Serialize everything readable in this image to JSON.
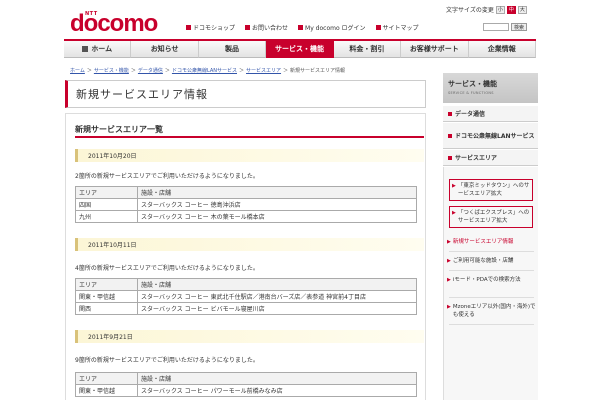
{
  "header": {
    "logo_small": "NTT",
    "logo": "docomo",
    "font_size_label": "文字サイズの変更",
    "font_sizes": [
      "小",
      "中",
      "大"
    ],
    "links": [
      "ドコモショップ",
      "お問い合わせ",
      "My docomo ログイン",
      "サイトマップ"
    ],
    "search_button": "検索"
  },
  "nav": {
    "tabs": [
      "ホーム",
      "お知らせ",
      "製品",
      "サービス・機能",
      "料金・割引",
      "お客様サポート",
      "企業情報"
    ],
    "active": "サービス・機能"
  },
  "breadcrumb": {
    "items": [
      "ホーム",
      "サービス・機能",
      "データ通信",
      "ドコモ公衆無線LANサービス",
      "サービスエリア"
    ],
    "current": "新規サービスエリア情報",
    "separator": "＞"
  },
  "main": {
    "page_title": "新規サービスエリア情報",
    "section_title": "新規サービスエリア一覧",
    "table_headers": [
      "エリア",
      "施設・店舗"
    ],
    "entries": [
      {
        "date": "2011年10月20日",
        "note": "2箇所の新規サービスエリアでご利用いただけるようになりました。",
        "rows": [
          [
            "四国",
            "スターバックス コーヒー 徳島沖浜店"
          ],
          [
            "九州",
            "スターバックス コーヒー 木の葉モール橋本店"
          ]
        ]
      },
      {
        "date": "2011年10月11日",
        "note": "4箇所の新規サービスエリアでご利用いただけるようになりました。",
        "rows": [
          [
            "関東・甲信越",
            "スターバックス コーヒー 東武北千住駅店／港南台バーズ店／表参道 神宮前4丁目店"
          ],
          [
            "関西",
            "スターバックス コーヒー ビバモール寝屋川店"
          ]
        ]
      },
      {
        "date": "2011年9月21日",
        "note": "9箇所の新規サービスエリアでご利用いただけるようになりました。",
        "rows": [
          [
            "関東・甲信越",
            "スターバックス コーヒー パワーモール前橋みなみ店"
          ]
        ]
      }
    ]
  },
  "sidebar": {
    "title": "サービス・機能",
    "title_en": "SERVICE & FUNCTIONS",
    "categories": [
      "データ通信",
      "ドコモ公衆無線LANサービス",
      "サービスエリア"
    ],
    "links": [
      "「東京ミッドタウン」へのサービスエリア拡大",
      "「つくばエクスプレス」へのサービスエリア拡大",
      "新規サービスエリア情報",
      "ご利用可能な施設・店舗",
      "iモード・PDAでの検索方法",
      "Mzoneエリア以外(国内・海外)でも使える"
    ],
    "current": "新規サービスエリア情報"
  },
  "colors": {
    "brand": "#c8002c",
    "date_band": "#fcf6d6",
    "sidebar_head": "#cccccc"
  }
}
